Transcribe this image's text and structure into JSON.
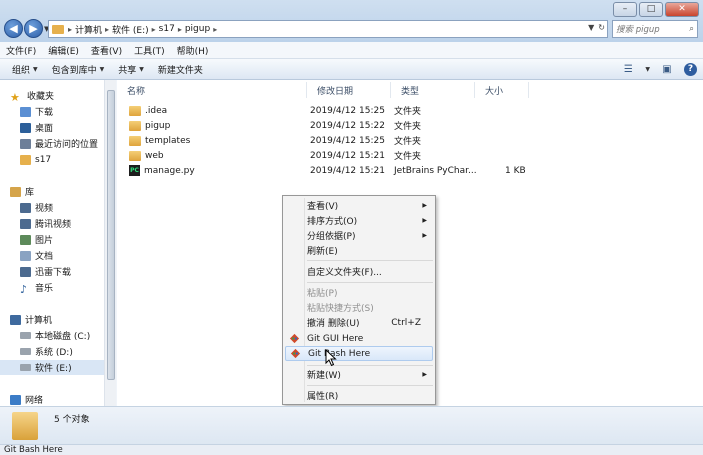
{
  "address": {
    "crumbs": [
      "计算机",
      "软件 (E:)",
      "s17",
      "pigup"
    ],
    "search_placeholder": "搜索 pigup"
  },
  "window_buttons": {
    "minimize": "–",
    "maximize": "□",
    "close": "✕"
  },
  "menubar": [
    "文件(F)",
    "编辑(E)",
    "查看(V)",
    "工具(T)",
    "帮助(H)"
  ],
  "toolbar": {
    "organize": "组织",
    "include": "包含到库中",
    "share": "共享",
    "new_folder": "新建文件夹"
  },
  "sidebar": {
    "favorites": {
      "label": "收藏夹",
      "items": [
        "下载",
        "桌面",
        "最近访问的位置",
        "s17"
      ]
    },
    "libraries": {
      "label": "库",
      "items": [
        "视频",
        "腾讯视频",
        "图片",
        "文档",
        "迅雷下载",
        "音乐"
      ]
    },
    "computer": {
      "label": "计算机",
      "items": [
        "本地磁盘 (C:)",
        "系统 (D:)",
        "软件 (E:)"
      ]
    },
    "network": {
      "label": "网络"
    }
  },
  "columns": {
    "name": "名称",
    "modified": "修改日期",
    "type": "类型",
    "size": "大小"
  },
  "files": [
    {
      "name": ".idea",
      "modified": "2019/4/12 15:25",
      "type": "文件夹",
      "size": "",
      "icon": "folder-icon"
    },
    {
      "name": "pigup",
      "modified": "2019/4/12 15:22",
      "type": "文件夹",
      "size": "",
      "icon": "folder-icon"
    },
    {
      "name": "templates",
      "modified": "2019/4/12 15:25",
      "type": "文件夹",
      "size": "",
      "icon": "folder-icon"
    },
    {
      "name": "web",
      "modified": "2019/4/12 15:21",
      "type": "文件夹",
      "size": "",
      "icon": "folder-icon"
    },
    {
      "name": "manage.py",
      "modified": "2019/4/12 15:21",
      "type": "JetBrains PyChar...",
      "size": "1 KB",
      "icon": "pycharm-file-icon"
    }
  ],
  "context_menu": {
    "view": "查看(V)",
    "sort": "排序方式(O)",
    "group": "分组依据(P)",
    "refresh": "刷新(E)",
    "customize": "自定义文件夹(F)...",
    "paste": "粘贴(P)",
    "paste_shortcut": "粘贴快捷方式(S)",
    "undo_delete": "撤消 删除(U)",
    "undo_shortcut": "Ctrl+Z",
    "git_gui": "Git GUI Here",
    "git_bash": "Git Bash Here",
    "new": "新建(W)",
    "properties": "属性(R)"
  },
  "details": {
    "count": "5 个对象"
  },
  "status": {
    "text": "Git Bash Here"
  },
  "colors": {
    "folder": "#e6b04c",
    "selection": "#d9e6f5",
    "accent": "#2e5d9f"
  }
}
